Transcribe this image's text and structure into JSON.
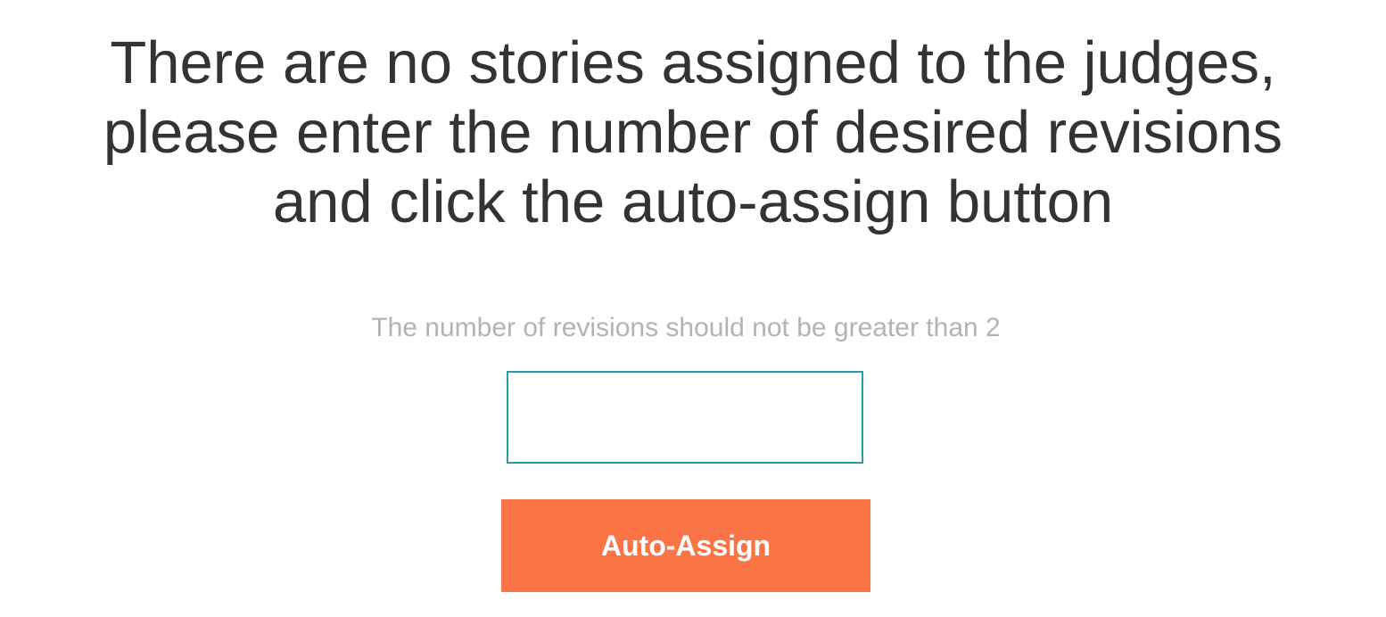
{
  "message": {
    "lines": [
      "There are no stories assigned to the judges,",
      "please enter the number of desired revisions",
      "and click the auto-assign button"
    ]
  },
  "form": {
    "hint": "The number of revisions should not be greater than 2",
    "revisions_value": "",
    "submit_label": "Auto-Assign"
  },
  "colors": {
    "text": "#333333",
    "hint": "#b3b3b3",
    "input_border": "#2a9aad",
    "button": "#fb7446",
    "button_text": "#ffffff"
  }
}
